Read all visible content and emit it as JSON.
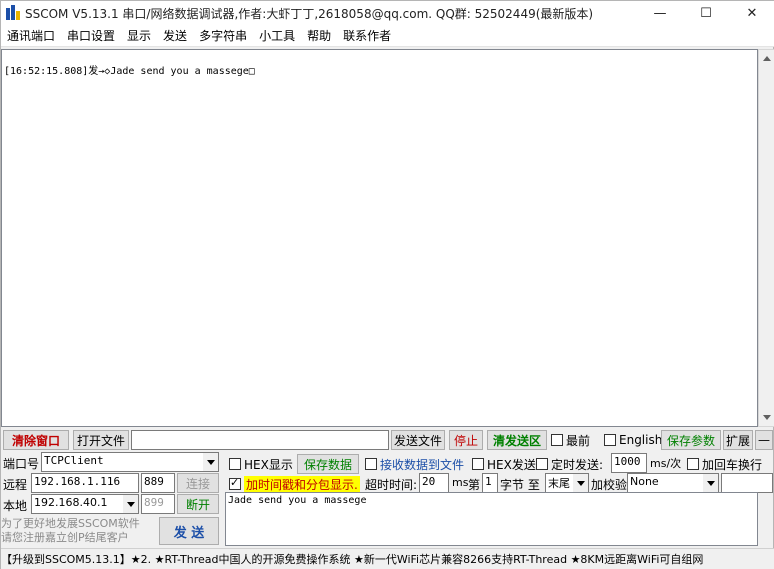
{
  "title_bar": {
    "title": "SSCOM V5.13.1 串口/网络数据调试器,作者:大虾丁丁,2618058@qq.com. QQ群: 52502449(最新版本)",
    "minimize": "—",
    "maximize": "☐",
    "close": "✕"
  },
  "menu": {
    "items": [
      "通讯端口",
      "串口设置",
      "显示",
      "发送",
      "多字符串",
      "小工具",
      "帮助",
      "联系作者"
    ]
  },
  "receive": {
    "log_line": "[16:52:15.808]发→◇Jade send you a massege□"
  },
  "toolbar": {
    "clear_window": "清除窗口",
    "open_file": "打开文件",
    "file_path": "",
    "send_file": "发送文件",
    "stop": "停止",
    "clear_send": "清发送区",
    "topmost": "最前",
    "english": "English",
    "save_params": "保存参数",
    "expand": "扩展",
    "minus": "—"
  },
  "connection": {
    "port_label": "端口号",
    "port_value": "TCPClient",
    "remote_label": "远程",
    "remote_ip": "192.168.1.116",
    "remote_port": "889",
    "connect": "连接",
    "local_label": "本地",
    "local_ip": "192.168.40.1",
    "local_port": "899",
    "disconnect": "断开"
  },
  "options": {
    "hex_display": "HEX显示",
    "save_data": "保存数据",
    "recv_to_file": "接收数据到文件",
    "hex_send": "HEX发送",
    "timed_send": "定时发送:",
    "interval": "1000",
    "interval_unit": "ms/次",
    "add_newline": "加回车换行",
    "timestamp": "加时间戳和分包显示.",
    "timeout_label": "超时时间:",
    "timeout_value": "20",
    "timeout_unit": "ms",
    "nth": "第",
    "byte_index": "1",
    "byte_to": "字节 至",
    "end_value": "末尾",
    "checksum_label": "加校验",
    "checksum_value": "None"
  },
  "send": {
    "text": "Jade send you a massege",
    "send_button": "发  送",
    "hint_line1": "为了更好地发展SSCOM软件",
    "hint_line2": "请您注册嘉立创P结尾客户"
  },
  "status": {
    "text": "【升级到SSCOM5.13.1】★2. ★RT-Thread中国人的开源免费操作系统 ★新一代WiFi芯片兼容8266支持RT-Thread ★8KM远距离WiFi可自组网"
  },
  "colors": {
    "accent_red": "#c00000",
    "accent_green": "#008000",
    "highlight_yellow": "#ffff00"
  }
}
